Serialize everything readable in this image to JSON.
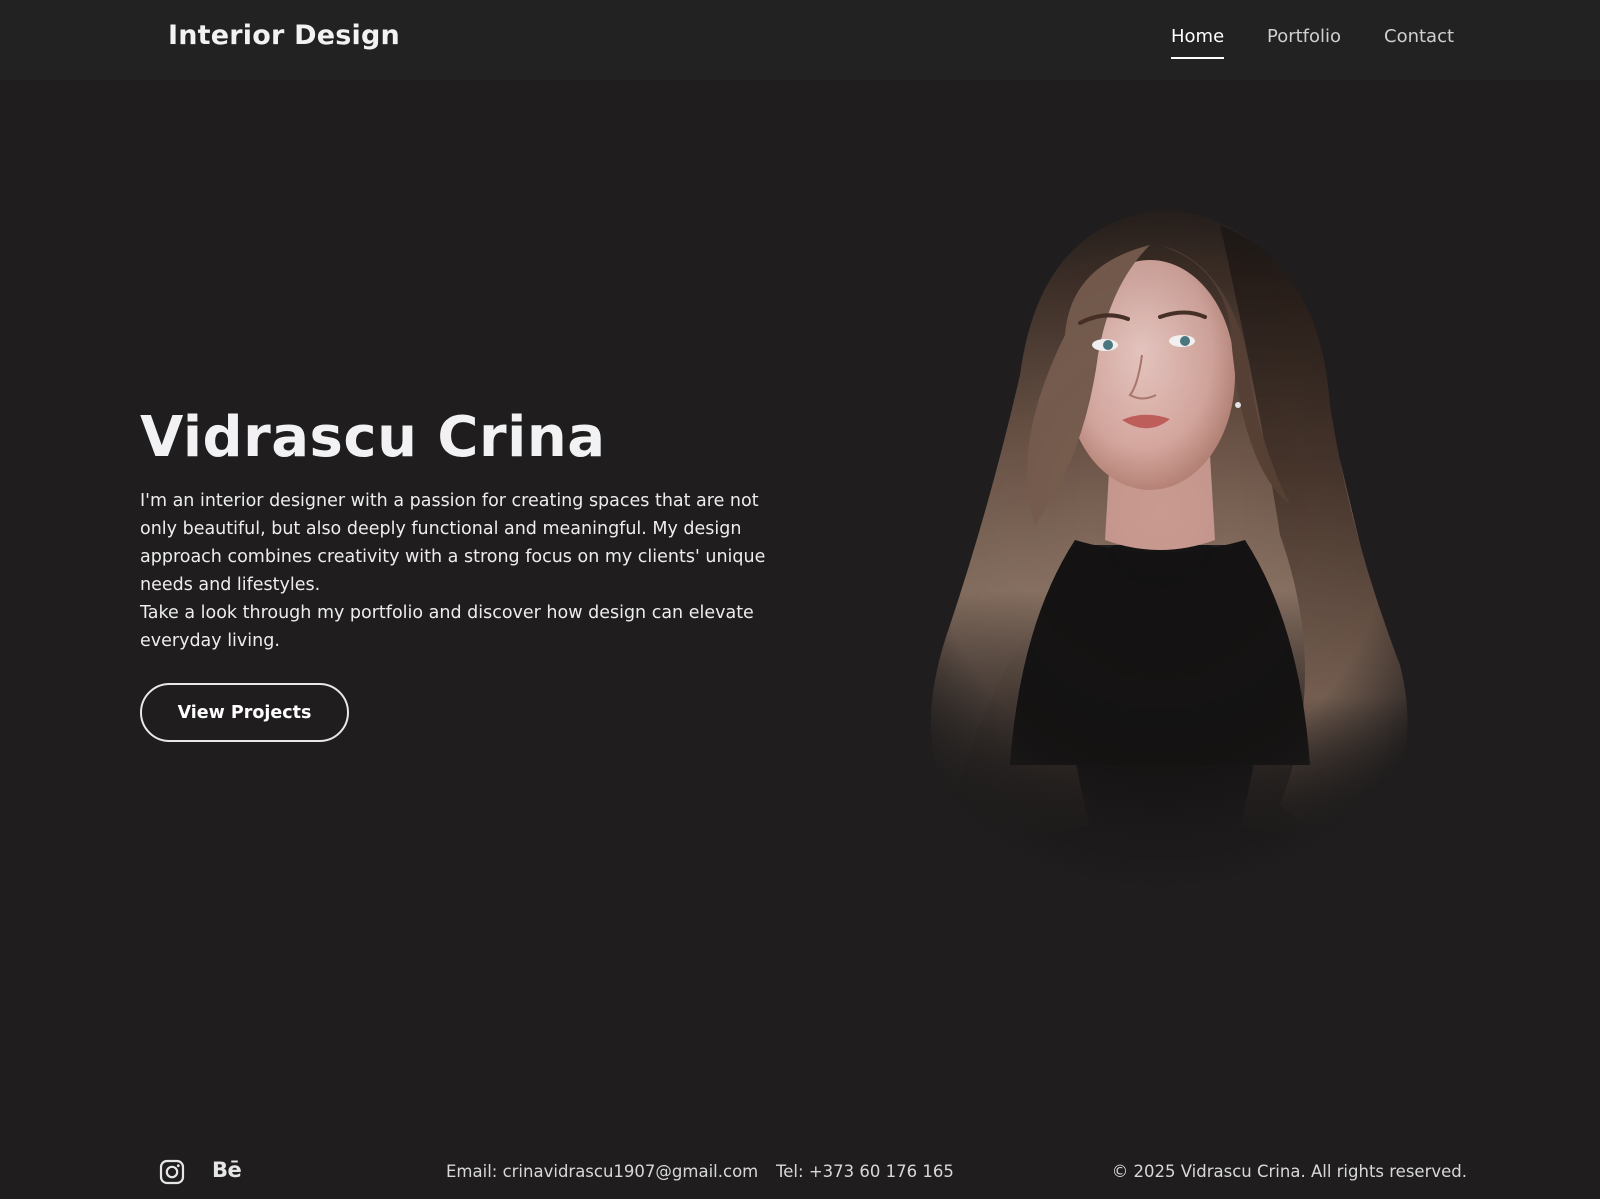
{
  "header": {
    "logo": "Interior Design",
    "nav": [
      {
        "label": "Home",
        "active": true
      },
      {
        "label": "Portfolio",
        "active": false
      },
      {
        "label": "Contact",
        "active": false
      }
    ]
  },
  "hero": {
    "title": "Vidrascu Crina",
    "paragraph1": "I'm an interior designer with a passion for creating spaces that are not only beautiful, but also deeply functional and meaningful. My design approach combines creativity with a strong focus on my clients' unique needs and lifestyles.",
    "paragraph2": "Take a look through my portfolio and discover how design can elevate everyday living.",
    "button_label": "View Projects"
  },
  "portrait": {
    "icon": "portrait-photo"
  },
  "footer": {
    "social": [
      {
        "icon": "instagram-icon"
      },
      {
        "icon": "behance-icon",
        "glyph": "Bē"
      }
    ],
    "email": "Email: crinavidrascu1907@gmail.com",
    "tel": "Tel: +373 60 176 165",
    "copyright": "© 2025 Vidrascu Crina. All rights reserved."
  },
  "colors": {
    "background": "#1f1d1d",
    "header_bg": "#232222",
    "text": "#ececec",
    "accent": "#ffffff"
  }
}
